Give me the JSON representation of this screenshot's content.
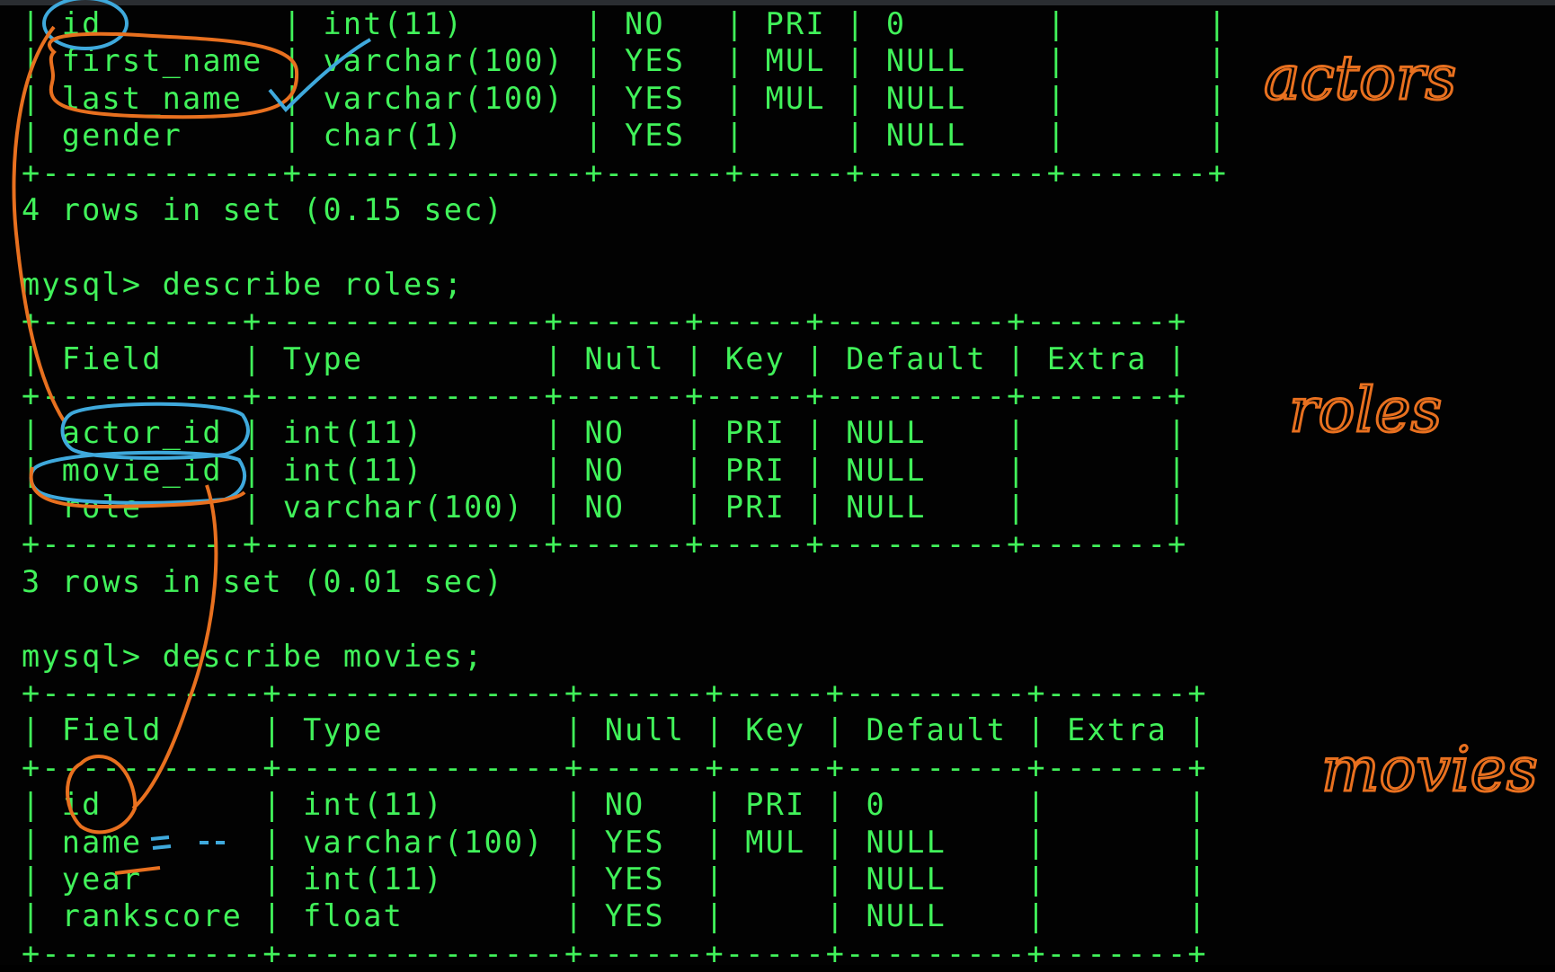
{
  "terminal": {
    "lines": [
      {
        "kind": "row",
        "text": "| id         | int(11)      | NO   | PRI | 0       |       |"
      },
      {
        "kind": "row",
        "text": "| first_name | varchar(100) | YES  | MUL | NULL    |       |"
      },
      {
        "kind": "row",
        "text": "| last_name  | varchar(100) | YES  | MUL | NULL    |       |"
      },
      {
        "kind": "row",
        "text": "| gender     | char(1)      | YES  |     | NULL    |       |"
      },
      {
        "kind": "border",
        "text": "+------------+--------------+------+-----+---------+-------+"
      },
      {
        "kind": "status",
        "text": "4 rows in set (0.15 sec)"
      },
      {
        "kind": "blank",
        "text": ""
      },
      {
        "kind": "prompt",
        "text": "mysql> describe roles;"
      },
      {
        "kind": "border",
        "text": "+----------+--------------+------+-----+---------+-------+"
      },
      {
        "kind": "header",
        "text": "| Field    | Type         | Null | Key | Default | Extra |"
      },
      {
        "kind": "border",
        "text": "+----------+--------------+------+-----+---------+-------+"
      },
      {
        "kind": "row",
        "text": "| actor_id | int(11)      | NO   | PRI | NULL    |       |"
      },
      {
        "kind": "row",
        "text": "| movie_id | int(11)      | NO   | PRI | NULL    |       |"
      },
      {
        "kind": "row",
        "text": "| role     | varchar(100) | NO   | PRI | NULL    |       |"
      },
      {
        "kind": "border",
        "text": "+----------+--------------+------+-----+---------+-------+"
      },
      {
        "kind": "status",
        "text": "3 rows in set (0.01 sec)"
      },
      {
        "kind": "blank",
        "text": ""
      },
      {
        "kind": "prompt",
        "text": "mysql> describe movies;"
      },
      {
        "kind": "border",
        "text": "+-----------+--------------+------+-----+---------+-------+"
      },
      {
        "kind": "header",
        "text": "| Field     | Type         | Null | Key | Default | Extra |"
      },
      {
        "kind": "border",
        "text": "+-----------+--------------+------+-----+---------+-------+"
      },
      {
        "kind": "row",
        "text": "| id        | int(11)      | NO   | PRI | 0       |       |"
      },
      {
        "kind": "row",
        "text": "| name      | varchar(100) | YES  | MUL | NULL    |       |"
      },
      {
        "kind": "row",
        "text": "| year      | int(11)      | YES  |     | NULL    |       |"
      },
      {
        "kind": "row",
        "text": "| rankscore | float        | YES  |     | NULL    |       |"
      },
      {
        "kind": "border",
        "text": "+-----------+--------------+------+-----+---------+-------+"
      }
    ]
  },
  "annotations": {
    "labels": {
      "actors": "actors",
      "roles": "roles",
      "movies": "movies"
    },
    "ink_colors": {
      "orange": "#e8701f",
      "blue": "#3fa9dc"
    }
  },
  "colors": {
    "terminal_text": "#41f25a",
    "background": "#020202"
  }
}
